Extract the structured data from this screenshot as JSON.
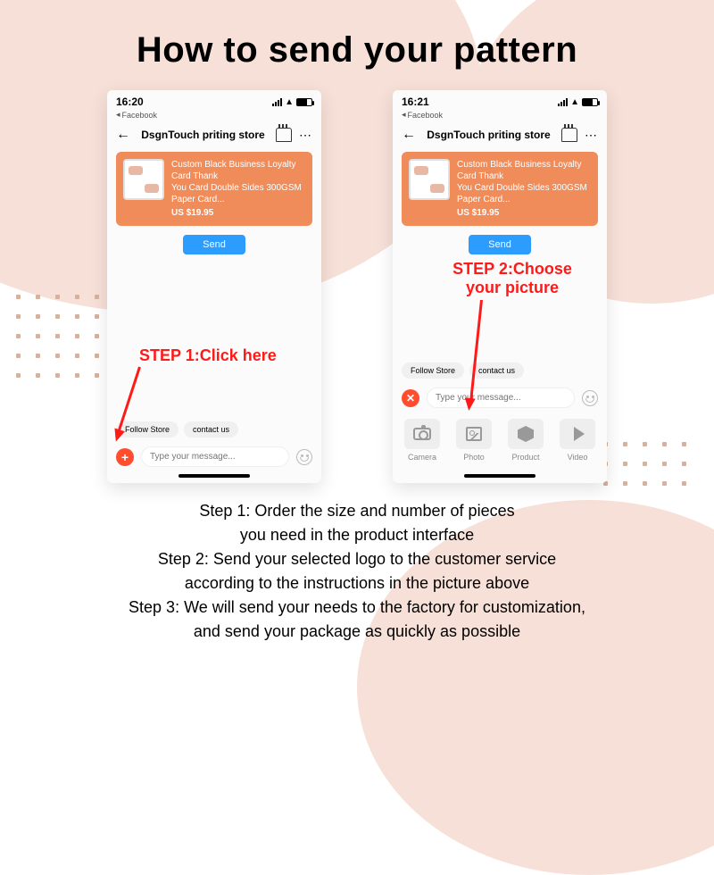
{
  "title": "How to send your pattern",
  "phone_left": {
    "time": "16:20",
    "back_app": "Facebook",
    "store_name": "DsgnTouch priting store",
    "product_line1": "Custom Black  Business Loyalty Card Thank",
    "product_line2": "You Card Double Sides 300GSM Paper Card...",
    "price": "US $19.95",
    "send": "Send",
    "pill_follow": "Follow Store",
    "pill_contact": "contact us",
    "placeholder": "Type your message...",
    "annotation": "STEP 1:Click here"
  },
  "phone_right": {
    "time": "16:21",
    "back_app": "Facebook",
    "store_name": "DsgnTouch priting store",
    "product_line1": "Custom Black  Business Loyalty Card Thank",
    "product_line2": "You Card Double Sides 300GSM Paper Card...",
    "price": "US $19.95",
    "send": "Send",
    "pill_follow": "Follow Store",
    "pill_contact": "contact us",
    "placeholder": "Type your message...",
    "annotation_l1": "STEP 2:Choose",
    "annotation_l2": "your picture",
    "att_camera": "Camera",
    "att_photo": "Photo",
    "att_product": "Product",
    "att_video": "Video"
  },
  "instr": {
    "s1a": "Step 1: Order the size and number of pieces",
    "s1b": "you need in the product interface",
    "s2a": "Step 2: Send your selected logo to the customer service",
    "s2b": "according to the instructions in the picture above",
    "s3a": "Step 3:  We will send your needs to the factory for customization,",
    "s3b": "and send your package as quickly as possible"
  }
}
